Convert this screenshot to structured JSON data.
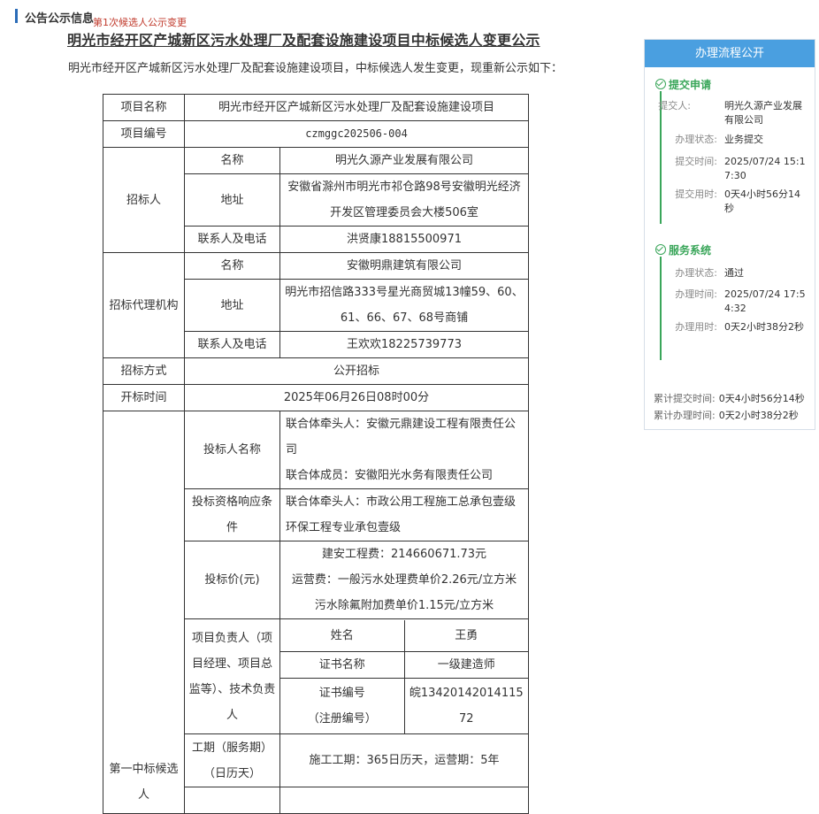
{
  "header": {
    "section_title": "公告公示信息",
    "change_note": "第1次候选人公示变更"
  },
  "doc": {
    "title": "明光市经开区产城新区污水处理厂及配套设施建设项目中标候选人变更公示",
    "intro": "明光市经开区产城新区污水处理厂及配套设施建设项目，中标候选人发生变更，现重新公示如下："
  },
  "table": {
    "project_name_label": "项目名称",
    "project_name": "明光市经开区产城新区污水处理厂及配套设施建设项目",
    "project_code_label": "项目编号",
    "project_code": "czmggc202506-004",
    "tenderer_label": "招标人",
    "name_label": "名称",
    "address_label": "地址",
    "contact_label": "联系人及电话",
    "tenderer_name": "明光久源产业发展有限公司",
    "tenderer_address": "安徽省滁州市明光市祁仓路98号安徽明光经济开发区管理委员会大楼506室",
    "tenderer_contact": "洪贤康18815500971",
    "agency_label": "招标代理机构",
    "agency_name": "安徽明鼎建筑有限公司",
    "agency_address": "明光市招信路333号星光商贸城13幢59、60、61、66、67、68号商铺",
    "agency_contact": "王欢欢18225739773",
    "method_label": "招标方式",
    "method": "公开招标",
    "open_time_label": "开标时间",
    "open_time": "2025年06月26日08时00分",
    "candidate_label": "第一中标候选人",
    "bidder_name_label": "投标人名称",
    "bidder_lead": "联合体牵头人：安徽元鼎建设工程有限责任公司",
    "bidder_member": "联合体成员：安徽阳光水务有限责任公司",
    "qual_label": "投标资格响应条件",
    "qual_1": "联合体牵头人：市政公用工程施工总承包壹级",
    "qual_2": "环保工程专业承包壹级",
    "price_label": "投标价(元)",
    "price_1": "建安工程费：214660671.73元",
    "price_2": "运营费：一般污水处理费单价2.26元/立方米",
    "price_3": "污水除氟附加费单价1.15元/立方米",
    "manager_label": "项目负责人（项目经理、项目总监等）、技术负责人",
    "person_name_label": "姓名",
    "person_name": "王勇",
    "cert_name_label": "证书名称",
    "cert_name": "一级建造师",
    "cert_no_label_1": "证书编号",
    "cert_no_label_2": "（注册编号）",
    "cert_no": "皖1342014201411572",
    "period_label": "工期（服务期）（日历天）",
    "period": "施工工期：365日历天，运营期：5年"
  },
  "process": {
    "title": "办理流程公开",
    "stage1": {
      "name": "提交申请",
      "submitter_label": "提交人:",
      "submitter": "明光久源产业发展有限公司",
      "status_label": "办理状态:",
      "status": "业务提交",
      "time_label": "提交时间:",
      "time": "2025/07/24 15:17:30",
      "duration_label": "提交用时:",
      "duration": "0天4小时56分14秒"
    },
    "stage2": {
      "name": "服务系统",
      "status_label": "办理状态:",
      "status": "通过",
      "time_label": "办理时间:",
      "time": "2025/07/24 17:54:32",
      "duration_label": "办理用时:",
      "duration": "0天2小时38分2秒"
    },
    "total_submit_label": "累计提交时间:",
    "total_submit": "0天4小时56分14秒",
    "total_handle_label": "累计办理时间:",
    "total_handle": "0天2小时38分2秒"
  },
  "colors": {
    "accent": "#4a9fe0",
    "success": "#3aa65a",
    "note_red": "#c0392b"
  }
}
